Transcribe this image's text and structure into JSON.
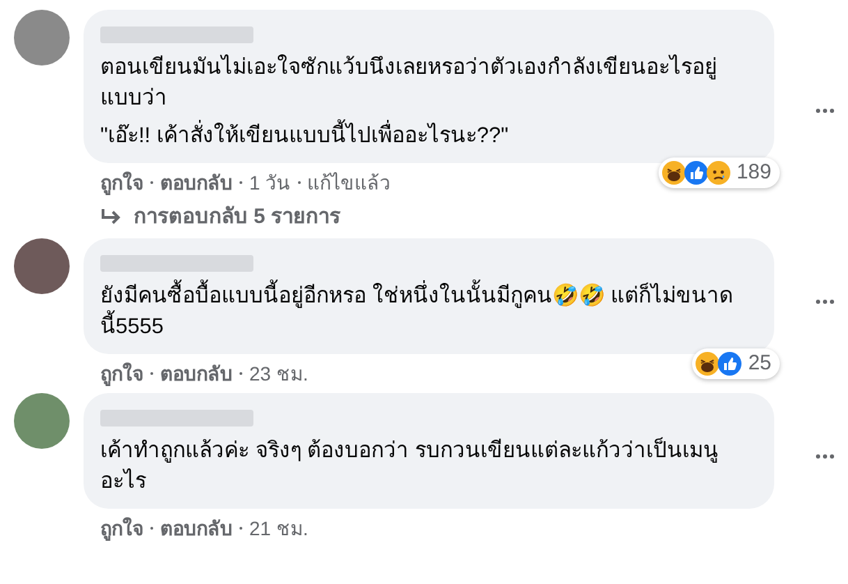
{
  "comments": [
    {
      "paragraphs": [
        "ตอนเขียนมันไม่เอะใจซักแว้บนึงเลยหรอว่าตัวเองกำลังเขียนอะไรอยู่ แบบว่า",
        "\"เอ๊ะ!! เค้าสั่งให้เขียนแบบนี้ไปเพื่ออะไรนะ??\""
      ],
      "reactions": [
        {
          "kind": "haha"
        },
        {
          "kind": "like"
        },
        {
          "kind": "sad"
        }
      ],
      "reaction_count": "189",
      "actions": [
        "ถูกใจ",
        "ตอบกลับ",
        "1 วัน",
        "แก้ไขแล้ว"
      ],
      "replies_link": "การตอบกลับ 5 รายการ"
    },
    {
      "paragraphs": [
        "ยังมีคนซื้อบื้อแบบนี้อยู่อีกหรอ ใช่หนึ่งในนั้นมีกูคน🤣🤣 แต่ก็ไม่ขนาดนี้5555"
      ],
      "reactions": [
        {
          "kind": "haha"
        },
        {
          "kind": "like"
        }
      ],
      "reaction_count": "25",
      "actions": [
        "ถูกใจ",
        "ตอบกลับ",
        "23 ชม."
      ]
    },
    {
      "paragraphs": [
        "เค้าทำถูกแล้วค่ะ จริงๆ ต้องบอกว่า รบกวนเขียนแต่ละแก้วว่าเป็นเมนูอะไร"
      ],
      "actions": [
        "ถูกใจ",
        "ตอบกลับ",
        "21 ชม."
      ]
    }
  ]
}
